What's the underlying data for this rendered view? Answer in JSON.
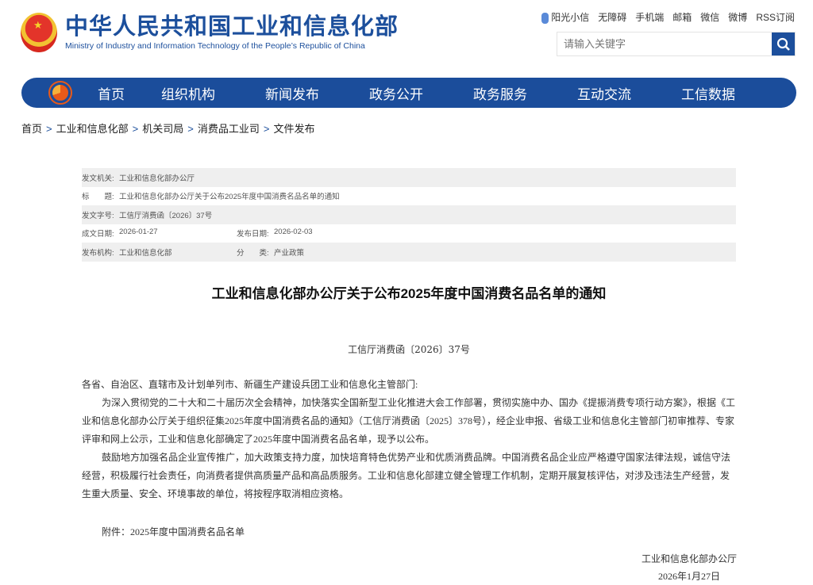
{
  "header": {
    "logo_cn": "中华人民共和国工业和信息化部",
    "logo_en": "Ministry of Industry and Information Technology of the People’s Republic of China",
    "links": [
      "阳光小信",
      "无障碍",
      "手机端",
      "邮箱",
      "微信",
      "微博",
      "RSS订阅"
    ],
    "search_placeholder": "请输入关键字"
  },
  "nav": [
    "首页",
    "组织机构",
    "新闻发布",
    "政务公开",
    "政务服务",
    "互动交流",
    "工信数据"
  ],
  "breadcrumb": [
    "首页",
    "工业和信息化部",
    "机关司局",
    "消费品工业司",
    "文件发布"
  ],
  "meta": {
    "issuer_label": "发文机关:",
    "issuer": "工业和信息化部办公厅",
    "title_label": "标　　题:",
    "title": "工业和信息化部办公厅关于公布2025年度中国消费名品名单的通知",
    "docno_label": "发文字号:",
    "docno": "工信厅消费函〔2026〕37号",
    "written_label": "成文日期:",
    "written": "2026-01-27",
    "published_label": "发布日期:",
    "published": "2026-02-03",
    "org_label": "发布机构:",
    "org": "工业和信息化部",
    "category_label": "分　　类:",
    "category": "产业政策"
  },
  "doc": {
    "title": "工业和信息化部办公厅关于公布2025年度中国消费名品名单的通知",
    "docno": "工信厅消费函〔2026〕37号",
    "salutation": "各省、自治区、直辖市及计划单列市、新疆生产建设兵团工业和信息化主管部门:",
    "p1": "为深入贯彻党的二十大和二十届历次全会精神，加快落实全国新型工业化推进大会工作部署，贯彻实施中办、国办《提振消费专项行动方案》，根据《工业和信息化部办公厅关于组织征集2025年度中国消费名品的通知》（工信厅消费函〔2025〕378号），经企业申报、省级工业和信息化主管部门初审推荐、专家评审和网上公示，工业和信息化部确定了2025年度中国消费名品名单，现予以公布。",
    "p2": "鼓励地方加强名品企业宣传推广，加大政策支持力度，加快培育特色优势产业和优质消费品牌。中国消费名品企业应严格遵守国家法律法规，诚信守法经营，积极履行社会责任，向消费者提供高质量产品和高品质服务。工业和信息化部建立健全管理工作机制，定期开展复核评估，对涉及违法生产经营，发生重大质量、安全、环境事故的单位，将按程序取消相应资格。",
    "attachment": "附件：2025年度中国消费名品名单",
    "signer": "工业和信息化部办公厅",
    "date": "2026年1月27日"
  }
}
